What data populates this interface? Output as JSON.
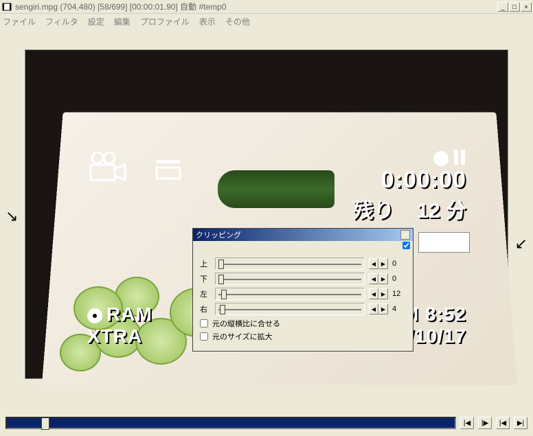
{
  "title": "sengiri.mpg (704,480) [58/699] [00:00:01.90] 自動 #temp0",
  "menubar": {
    "items": [
      "ファイル",
      "フィルタ",
      "設定",
      "編集",
      "プロファイル",
      "表示",
      "その他"
    ]
  },
  "osd": {
    "timecode": "0:00:00",
    "remaining_label": "残り",
    "remaining_value": "12",
    "remaining_unit": "分",
    "ram": "RAM",
    "xtra": "XTRA",
    "clock": "PM 8:52",
    "date": "2004/10/17"
  },
  "clip": {
    "title": "クリッピング",
    "rows": [
      {
        "label": "上",
        "value": "0",
        "pos": 4
      },
      {
        "label": "下",
        "value": "0",
        "pos": 4
      },
      {
        "label": "左",
        "value": "12",
        "pos": 8
      },
      {
        "label": "右",
        "value": "4",
        "pos": 6
      }
    ],
    "keep_aspect": "元の縦横比に合せる",
    "expand_size": "元のサイズに拡大"
  },
  "controls": {
    "minimize": "_",
    "maximize": "□",
    "close": "×",
    "step_left": "◀",
    "step_right": "▶",
    "prev_frame": "|◀",
    "play": "|▶",
    "first": "|◀",
    "last": "▶|"
  }
}
